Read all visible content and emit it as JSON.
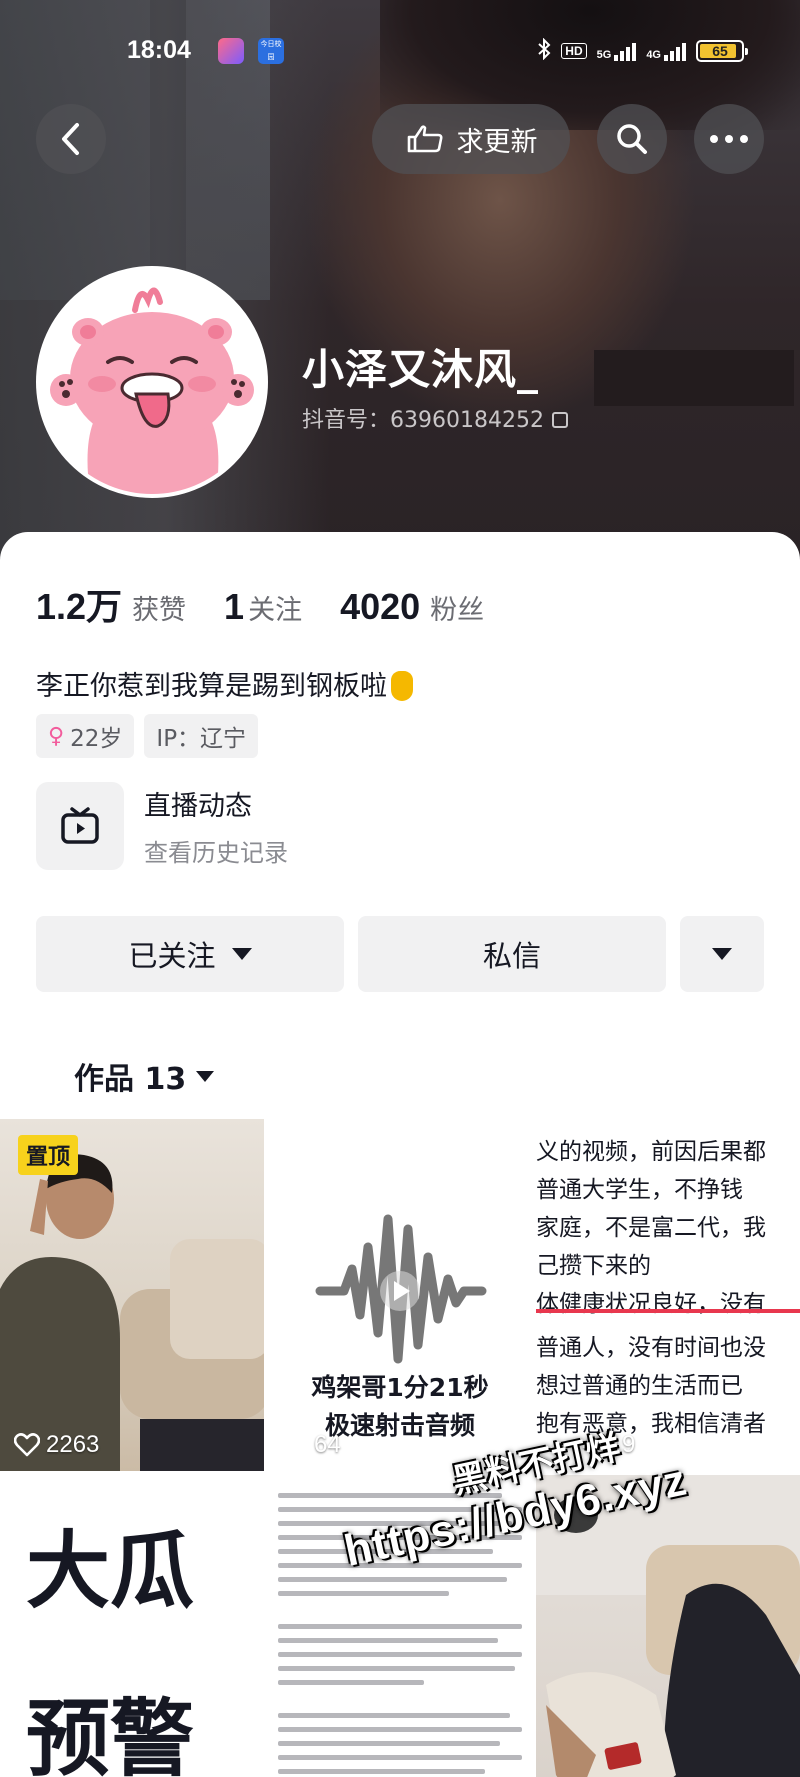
{
  "status": {
    "time": "18:04",
    "app_icon_2_label": "今日校园",
    "hd_label": "HD",
    "net_1": "5G",
    "net_2": "4G",
    "battery": "65"
  },
  "header": {
    "update_label": "求更新"
  },
  "profile": {
    "name": "小泽又沐风_",
    "douyin_id": "抖音号：63960184252",
    "likes_count": "1.2万",
    "likes_label": "获赞",
    "following_count": "1",
    "following_label": "关注",
    "followers_count": "4020",
    "followers_label": "粉丝",
    "bio": "李正你惹到我算是踢到钢板啦",
    "tags": {
      "age": "22岁",
      "ip": "IP：辽宁"
    }
  },
  "live": {
    "title": "直播动态",
    "subtitle": "查看历史记录"
  },
  "actions": {
    "follow_label": "已关注",
    "message_label": "私信"
  },
  "works": {
    "tab_label": "作品 13",
    "items": [
      {
        "badge": "置顶",
        "likes": "2263"
      },
      {
        "title_line1": "鸡架哥1分21秒",
        "title_line2": "极速射击音频",
        "likes": "64"
      },
      {
        "lines": [
          "义的视频，前因后果都",
          "普通大学生，不挣钱",
          "家庭，不是富二代，我",
          "己攒下来的",
          "体健康状况良好，没有",
          "普通人，没有时间也没",
          "想过普通的生活而已",
          "抱有恶意，我相信清者"
        ],
        "likes": "4219"
      },
      {
        "line1": "大瓜",
        "line2": "预警"
      },
      {},
      {}
    ]
  },
  "watermark": {
    "line1": "黑料不打烊",
    "line2": "https://bdy6.xyz"
  }
}
